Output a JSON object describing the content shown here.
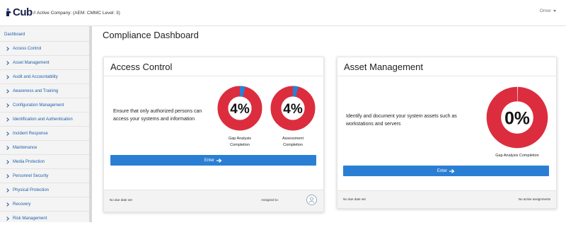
{
  "header": {
    "logo_text": "Cub",
    "company": "// Active Company: (AEM: CMMC Level: 3)",
    "user": "Omer"
  },
  "sidebar": {
    "title": "Dashboard",
    "items": [
      {
        "label": "Access Control"
      },
      {
        "label": "Asset Management"
      },
      {
        "label": "Audit and Accountability"
      },
      {
        "label": "Awareness and Training"
      },
      {
        "label": "Configuration Management"
      },
      {
        "label": "Identification and Authentication"
      },
      {
        "label": "Incident Response"
      },
      {
        "label": "Maintenance"
      },
      {
        "label": "Media Protection"
      },
      {
        "label": "Personnel Security"
      },
      {
        "label": "Physical Protection"
      },
      {
        "label": "Recovery"
      },
      {
        "label": "Risk Management"
      }
    ]
  },
  "page_title": "Compliance Dashboard",
  "cards": [
    {
      "title": "Access Control",
      "description": "Ensure that only authorized persons can access your systems and information",
      "gauges": [
        {
          "percent_text": "4%",
          "value": 0.04,
          "label": "Gap Analysis Completion"
        },
        {
          "percent_text": "4%",
          "value": 0.04,
          "label": "Assessment Completion"
        }
      ],
      "enter_label": "Enter",
      "footer_left": "No due date set",
      "footer_right": "Assigned to:"
    },
    {
      "title": "Asset Management",
      "description": "Identify and document your system assets such as workstations and servers",
      "gauges": [
        {
          "percent_text": "0%",
          "value": 0.0,
          "label": "Gap Analysis Completion"
        }
      ],
      "enter_label": "Enter",
      "footer_left": "No due date set",
      "footer_right": "No active assignments"
    }
  ],
  "colors": {
    "gauge_remaining": "#dc2d3f",
    "gauge_done": "#2a7fd4",
    "button": "#2a7fd4",
    "link": "#1f5fa8"
  },
  "icons": {
    "logo": "cub-logo-icon",
    "chevron": "chevron-right-icon",
    "caret": "caret-down-icon",
    "avatar": "user-avatar-icon",
    "arrow": "arrow-right-icon"
  }
}
